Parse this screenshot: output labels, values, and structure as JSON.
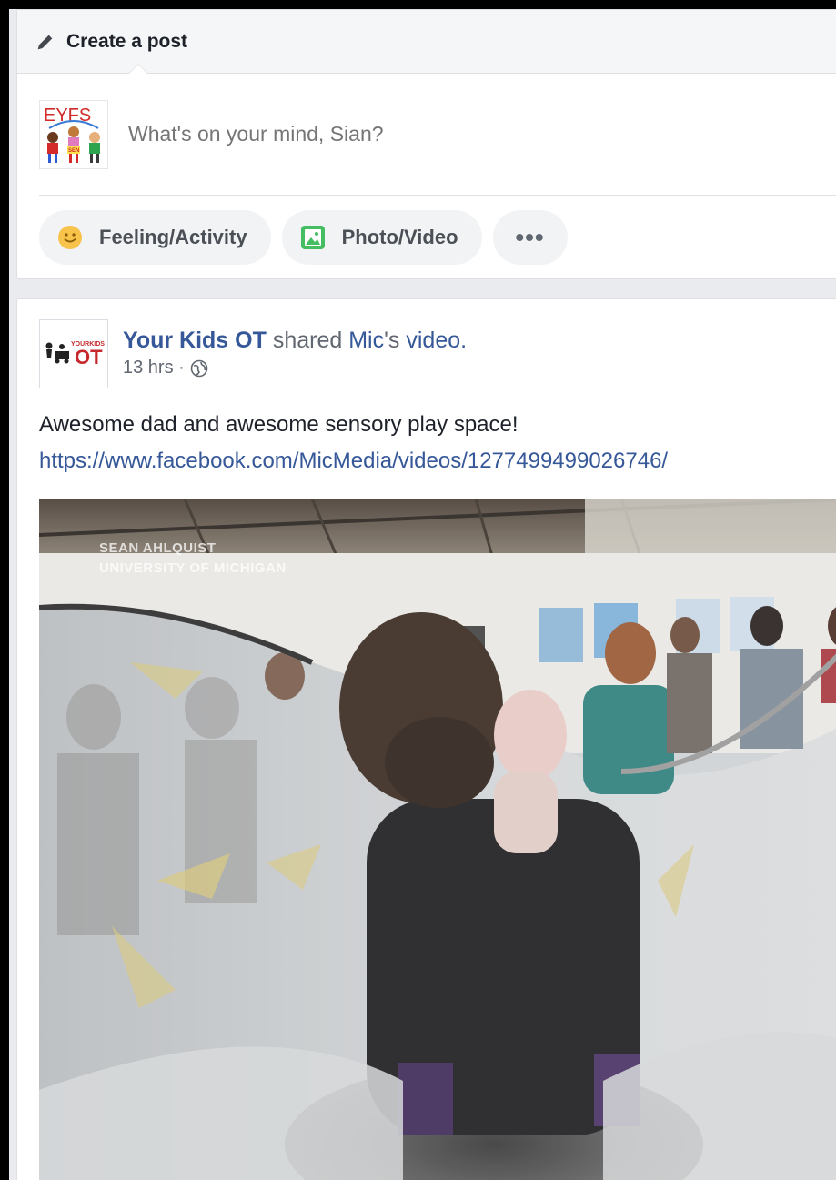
{
  "composer": {
    "title": "Create a post",
    "avatar_text": "EYFS",
    "avatar_badge": "SEN",
    "placeholder": "What's on your mind, Sian?",
    "actions": [
      {
        "label": "Feeling/Activity",
        "icon": "smiley-icon"
      },
      {
        "label": "Photo/Video",
        "icon": "photo-icon"
      },
      {
        "label": "•••",
        "icon": "more-icon"
      }
    ]
  },
  "post": {
    "author": "Your Kids OT",
    "verb": "shared",
    "source": "Mic",
    "source_suffix": "'s",
    "object": "video.",
    "time": "13 hrs · ",
    "text": "Awesome dad and awesome sensory play space!",
    "url": "https://www.facebook.com/MicMedia/videos/1277499499026746/",
    "avatar_text_top": "YOURKIDS",
    "avatar_text_main": "OT",
    "video": {
      "watermark_line1": "SEAN AHLQUIST",
      "watermark_line2": "UNIVERSITY OF MICHIGAN"
    }
  },
  "colors": {
    "link": "#365899",
    "background": "#e9ebee",
    "pill": "#f2f3f5"
  }
}
